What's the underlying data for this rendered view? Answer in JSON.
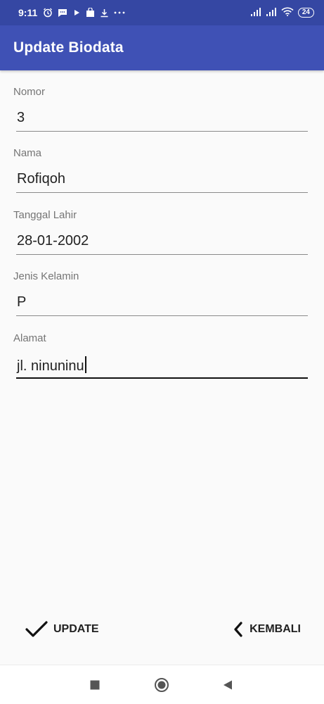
{
  "status_bar": {
    "time": "9:11",
    "battery": "24",
    "icons": [
      "alarm-icon",
      "message-icon",
      "play-icon",
      "shop-icon",
      "download-icon",
      "more-icon",
      "signal-icon",
      "signal-icon",
      "wifi-icon",
      "battery-icon"
    ]
  },
  "app_bar": {
    "title": "Update Biodata",
    "color": "#3f51b5"
  },
  "form": {
    "nomor": {
      "label": "Nomor",
      "value": "3"
    },
    "nama": {
      "label": "Nama",
      "value": "Rofiqoh"
    },
    "tanggal_lahir": {
      "label": "Tanggal Lahir",
      "value": "28-01-2002"
    },
    "jenis_kelamin": {
      "label": "Jenis Kelamin",
      "value": "P"
    },
    "alamat": {
      "label": "Alamat",
      "value": "jl. ninuninu"
    }
  },
  "actions": {
    "update_label": "UPDATE",
    "kembali_label": "KEMBALI"
  },
  "nav_bar": {
    "icons": [
      "recents-icon",
      "home-icon",
      "back-icon"
    ]
  }
}
